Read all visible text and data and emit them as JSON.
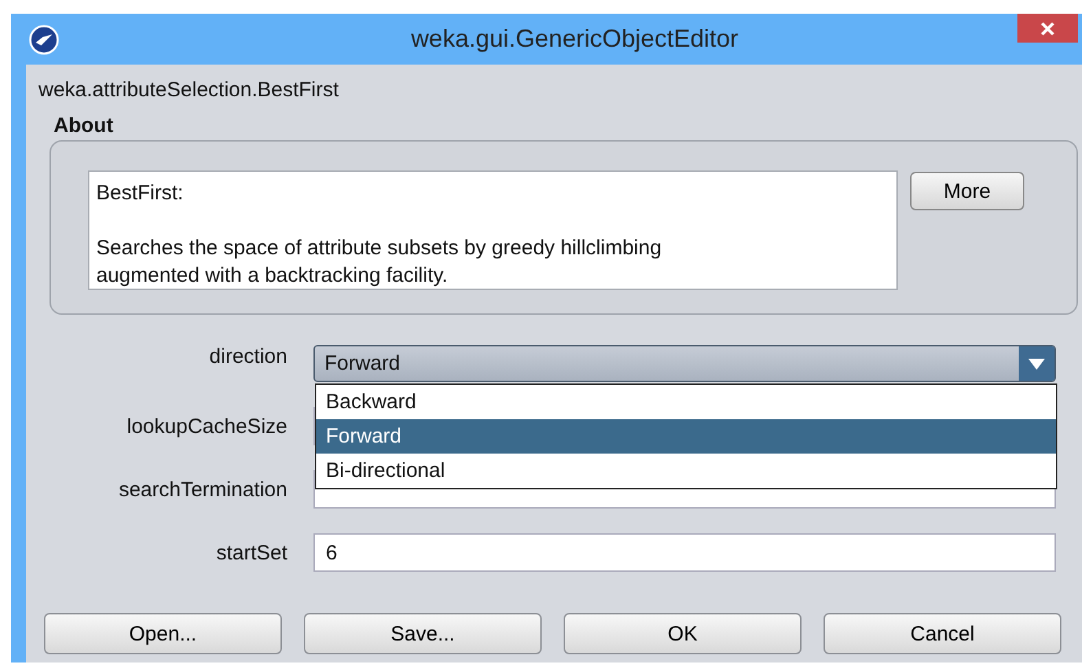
{
  "window": {
    "title": "weka.gui.GenericObjectEditor"
  },
  "class_name": "weka.attributeSelection.BestFirst",
  "about": {
    "heading": "About",
    "title": "BestFirst:",
    "description": "Searches the space of attribute subsets by greedy hillclimbing\naugmented with a backtracking facility.",
    "more_button": "More"
  },
  "properties": [
    {
      "label": "direction",
      "kind": "combo",
      "value": "Forward",
      "open": true,
      "options": [
        {
          "label": "Backward",
          "selected": false
        },
        {
          "label": "Forward",
          "selected": true
        },
        {
          "label": "Bi-directional",
          "selected": false
        }
      ]
    },
    {
      "label": "lookupCacheSize",
      "kind": "text"
    },
    {
      "label": "searchTermination",
      "kind": "text"
    },
    {
      "label": "startSet",
      "kind": "text",
      "value": "6"
    }
  ],
  "buttons": [
    "Open...",
    "Save...",
    "OK",
    "Cancel"
  ]
}
